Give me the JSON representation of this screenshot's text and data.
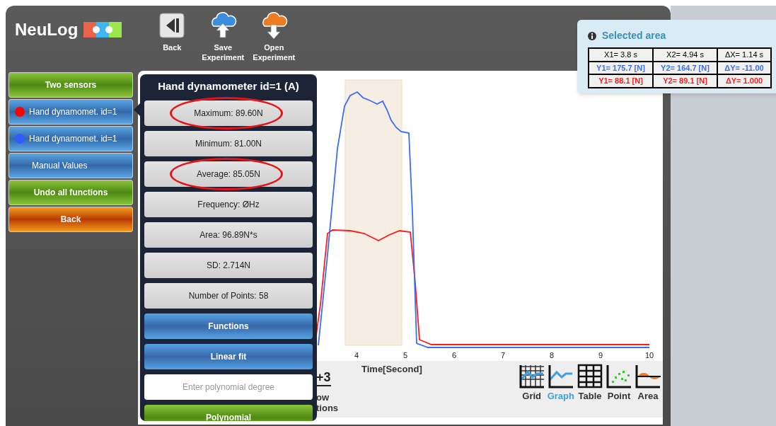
{
  "logo": {
    "text": "NeuLog"
  },
  "header_buttons": [
    {
      "kind": "back",
      "label": "Back"
    },
    {
      "kind": "save",
      "label": "Save Experiment"
    },
    {
      "kind": "open",
      "label": "Open Experiment"
    }
  ],
  "sidebar": [
    {
      "kind": "action",
      "label": "Two sensors"
    },
    {
      "kind": "sensor",
      "label": "Hand dynamomet. id=1",
      "color": "#ff0000"
    },
    {
      "kind": "sensor",
      "label": "Hand dynamomet. id=1",
      "color": "#2f5bff"
    },
    {
      "kind": "plain",
      "label": "Manual Values"
    },
    {
      "kind": "action",
      "label": "Undo all functions"
    },
    {
      "kind": "back",
      "label": "Back"
    }
  ],
  "popup": {
    "title": "Hand dynamometer id=1 (A)",
    "stats": [
      {
        "text": "Maximum: 89.60N",
        "highlighted": true
      },
      {
        "text": "Minimum: 81.00N",
        "highlighted": false
      },
      {
        "text": "Average: 85.05N",
        "highlighted": true
      },
      {
        "text": "Frequency: ØHz",
        "highlighted": false
      },
      {
        "text": "Area: 96.89N*s",
        "highlighted": false
      },
      {
        "text": "SD: 2.714N",
        "highlighted": false
      },
      {
        "text": "Number of Points: 58",
        "highlighted": false
      }
    ],
    "buttons": [
      {
        "kind": "blue",
        "label": "Functions"
      },
      {
        "kind": "blue",
        "label": "Linear fit"
      }
    ],
    "degree_field": {
      "placeholder": "Enter polynomial degree"
    },
    "polynomial_button": {
      "label": "Polynomial"
    }
  },
  "graph": {
    "x_ticks": [
      "4",
      "5",
      "6",
      "7",
      "8",
      "9",
      "10"
    ],
    "x_axis_label": "Time[Second]"
  },
  "toolbar": {
    "partial_icon_text": "+3",
    "partial_label_lines": [
      "ow",
      "tions"
    ],
    "views": [
      {
        "kind": "grid",
        "label": "Grid",
        "selected": false
      },
      {
        "kind": "graph",
        "label": "Graph",
        "selected": true
      },
      {
        "kind": "table",
        "label": "Table",
        "selected": false
      },
      {
        "kind": "point",
        "label": "Point",
        "selected": false
      },
      {
        "kind": "area",
        "label": "Area",
        "selected": false
      }
    ]
  },
  "selected_area": {
    "title": "Selected area",
    "rows": [
      {
        "color": "#000000",
        "cells": [
          "X1= 3.8 s",
          "X2= 4.94 s",
          "ΔX= 1.14 s"
        ]
      },
      {
        "color": "#3b6cf6",
        "cells": [
          "Y1= 175.7 [N]",
          "Y2= 164.7 [N]",
          "ΔY= -11.00"
        ]
      },
      {
        "color": "#ff1a1a",
        "cells": [
          "Y1= 88.1 [N]",
          "Y2= 89.1 [N]",
          "ΔY= 1.000"
        ]
      }
    ]
  }
}
